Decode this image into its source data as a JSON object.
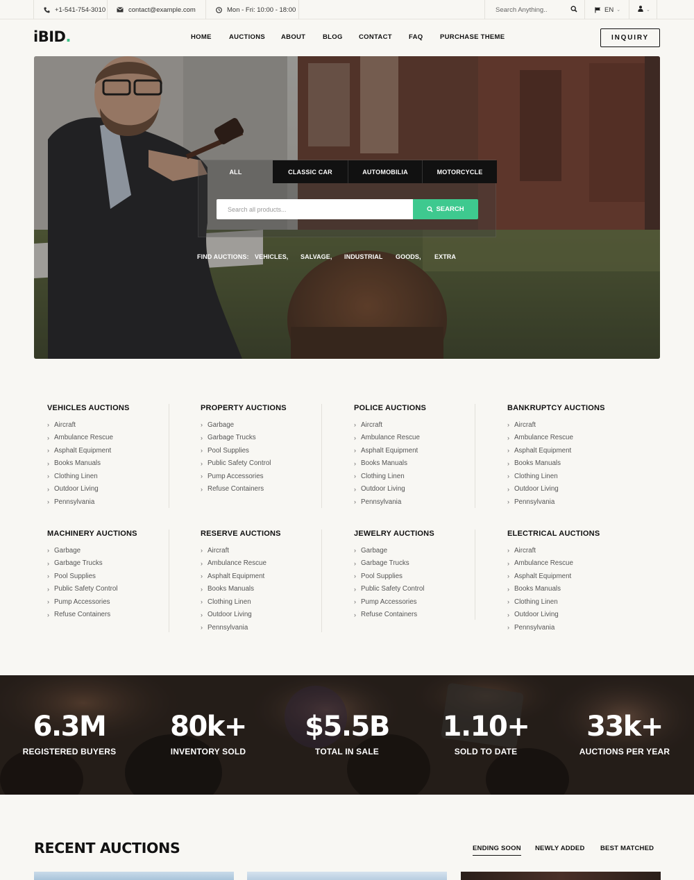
{
  "topbar": {
    "phone": "+1-541-754-3010",
    "email": "contact@example.com",
    "hours": "Mon - Fri: 10:00 - 18:00",
    "search_placeholder": "Search Anything..",
    "language": "EN"
  },
  "header": {
    "logo_text": "iBID",
    "logo_dot": ".",
    "nav": [
      "HOME",
      "AUCTIONS",
      "ABOUT",
      "BLOG",
      "CONTACT",
      "FAQ",
      "PURCHASE THEME"
    ],
    "inquiry_label": "INQUIRY"
  },
  "hero": {
    "tabs": [
      "ALL",
      "CLASSIC CAR",
      "AUTOMOBILIA",
      "MOTORCYCLE"
    ],
    "active_tab": "ALL",
    "search_placeholder": "Search all products...",
    "search_button": "SEARCH",
    "find_label": "FIND AUCTIONS:",
    "find_links": [
      "VEHICLES,",
      "SALVAGE,",
      "INDUSTRIAL",
      "GOODS,",
      "EXTRA"
    ]
  },
  "categories": [
    {
      "title": "VEHICLES AUCTIONS",
      "items": [
        "Aircraft",
        "Ambulance Rescue",
        "Asphalt Equipment",
        "Books Manuals",
        "Clothing Linen",
        "Outdoor Living",
        "Pennsylvania"
      ]
    },
    {
      "title": "PROPERTY AUCTIONS",
      "items": [
        "Garbage",
        "Garbage Trucks",
        "Pool Supplies",
        "Public Safety Control",
        "Pump Accessories",
        "Refuse Containers"
      ]
    },
    {
      "title": "POLICE AUCTIONS",
      "items": [
        "Aircraft",
        "Ambulance Rescue",
        "Asphalt Equipment",
        "Books Manuals",
        "Clothing Linen",
        "Outdoor Living",
        "Pennsylvania"
      ]
    },
    {
      "title": "BANKRUPTCY AUCTIONS",
      "items": [
        "Aircraft",
        "Ambulance Rescue",
        "Asphalt Equipment",
        "Books Manuals",
        "Clothing Linen",
        "Outdoor Living",
        "Pennsylvania"
      ]
    },
    {
      "title": "MACHINERY AUCTIONS",
      "items": [
        "Garbage",
        "Garbage Trucks",
        "Pool Supplies",
        "Public Safety Control",
        "Pump Accessories",
        "Refuse Containers"
      ]
    },
    {
      "title": "RESERVE AUCTIONS",
      "items": [
        "Aircraft",
        "Ambulance Rescue",
        "Asphalt Equipment",
        "Books Manuals",
        "Clothing Linen",
        "Outdoor Living",
        "Pennsylvania"
      ]
    },
    {
      "title": "JEWELRY AUCTIONS",
      "items": [
        "Garbage",
        "Garbage Trucks",
        "Pool Supplies",
        "Public Safety Control",
        "Pump Accessories",
        "Refuse Containers"
      ]
    },
    {
      "title": "ELECTRICAL AUCTIONS",
      "items": [
        "Aircraft",
        "Ambulance Rescue",
        "Asphalt Equipment",
        "Books Manuals",
        "Clothing Linen",
        "Outdoor Living",
        "Pennsylvania"
      ]
    }
  ],
  "stats": [
    {
      "value": "6.3M",
      "label": "REGISTERED BUYERS"
    },
    {
      "value": "80k+",
      "label": "INVENTORY SOLD"
    },
    {
      "value": "$5.5B",
      "label": "TOTAL IN SALE"
    },
    {
      "value": "1.10+",
      "label": "SOLD TO DATE"
    },
    {
      "value": "33k+",
      "label": "AUCTIONS PER YEAR"
    }
  ],
  "recent": {
    "title": "RECENT AUCTIONS",
    "tabs": [
      "ENDING SOON",
      "NEWLY ADDED",
      "BEST MATCHED"
    ],
    "active_tab": "ENDING SOON"
  },
  "colors": {
    "accent": "#3ec98f",
    "background": "#f8f7f3",
    "dark": "#111111"
  }
}
